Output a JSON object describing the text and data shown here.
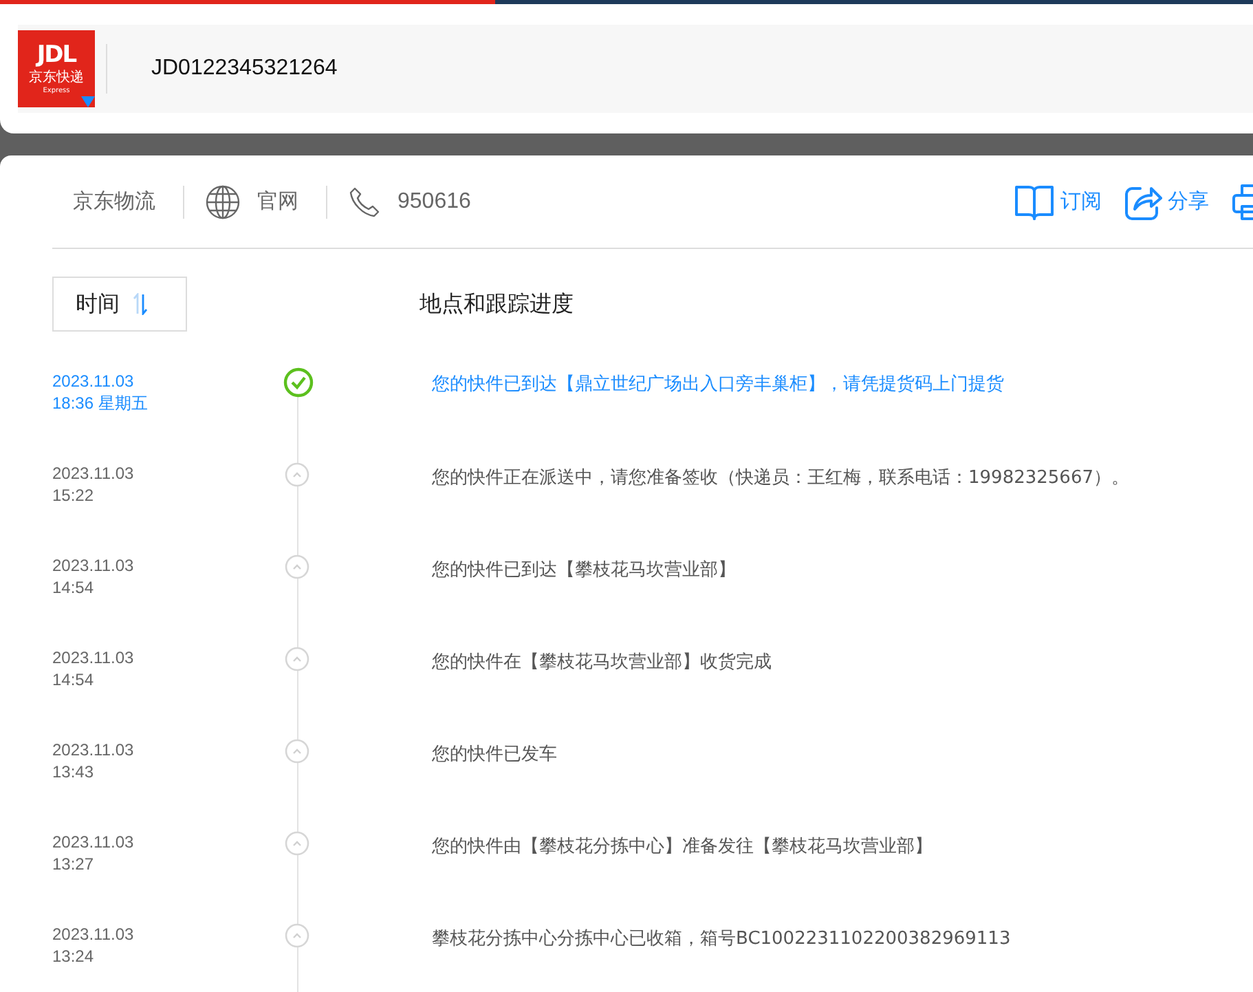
{
  "logo": {
    "mark": "JDL",
    "name": "京东快递",
    "sub": "Express"
  },
  "tracking_number": "JD0122345321264",
  "carrier": {
    "name": "京东物流",
    "website": "官网",
    "phone": "950616"
  },
  "actions": [
    {
      "kind": "subscribe",
      "label": "订阅"
    },
    {
      "kind": "share",
      "label": "分享"
    },
    {
      "kind": "print"
    }
  ],
  "sort": {
    "label": "时间"
  },
  "detail_heading": "地点和跟踪进度",
  "events": [
    {
      "date": "2023.11.03",
      "time": "18:36 星期五",
      "text": "您的快件已到达【鼎立世纪广场出入口旁丰巢柜】，请凭提货码上门提货",
      "latest": true
    },
    {
      "date": "2023.11.03",
      "time": "15:22",
      "text": "您的快件正在派送中，请您准备签收（快递员：王红梅，联系电话：19982325667）。",
      "latest": false
    },
    {
      "date": "2023.11.03",
      "time": "14:54",
      "text": "您的快件已到达【攀枝花马坎营业部】",
      "latest": false
    },
    {
      "date": "2023.11.03",
      "time": "14:54",
      "text": "您的快件在【攀枝花马坎营业部】收货完成",
      "latest": false
    },
    {
      "date": "2023.11.03",
      "time": "13:43",
      "text": "您的快件已发车",
      "latest": false
    },
    {
      "date": "2023.11.03",
      "time": "13:27",
      "text": "您的快件由【攀枝花分拣中心】准备发往【攀枝花马坎营业部】",
      "latest": false
    },
    {
      "date": "2023.11.03",
      "time": "13:24",
      "text": "攀枝花分拣中心分拣中心已收箱，箱号BC1002231102200382969113",
      "latest": false
    }
  ]
}
